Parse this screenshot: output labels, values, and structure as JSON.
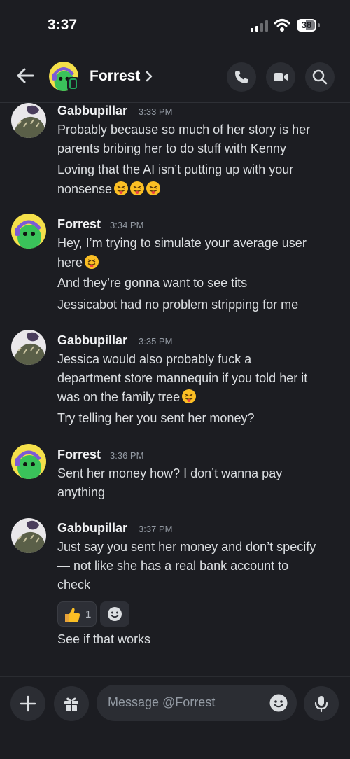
{
  "status_bar": {
    "time": "3:37",
    "battery": "38"
  },
  "header": {
    "name": "Forrest",
    "chevron": "›"
  },
  "messages": [
    {
      "author": "Gabbupillar",
      "time": "3:33 PM",
      "lines": [
        "Probably because so much of her story is her",
        "parents bribing her to do stuff with Kenny",
        "Loving that the AI isn’t putting up with your",
        "nonsense"
      ]
    },
    {
      "author": "Forrest",
      "time": "3:34 PM",
      "lines": [
        "Hey, I’m trying to simulate your average user",
        "here",
        "And they’re gonna want to see tits",
        "Jessicabot had no problem stripping for me"
      ]
    },
    {
      "author": "Gabbupillar",
      "time": "3:35 PM",
      "lines": [
        "Jessica would also probably fuck a",
        "department store mannequin if you told her it",
        "was on the family tree",
        "Try telling her you sent her money?"
      ]
    },
    {
      "author": "Forrest",
      "time": "3:36 PM",
      "lines": [
        "Sent her money how? I don’t wanna pay",
        "anything"
      ]
    },
    {
      "author": "Gabbupillar",
      "time": "3:37 PM",
      "lines": [
        "Just say you sent her money and don’t specify",
        "— not like she has a real bank account to",
        "check",
        "See if that works"
      ],
      "reaction": {
        "emoji": "thumbs-up",
        "count": "1"
      }
    }
  ],
  "composer": {
    "placeholder": "Message @Forrest"
  },
  "colors": {
    "background": "#1c1d22",
    "green_avatar": "#3ac25a",
    "yellow_avatar_bg": "#f5e04a",
    "online": "#23a55a"
  },
  "icons": [
    "back-arrow-icon",
    "phone-icon",
    "video-icon",
    "search-icon",
    "plus-icon",
    "gift-icon",
    "emoji-icon",
    "microphone-icon"
  ]
}
